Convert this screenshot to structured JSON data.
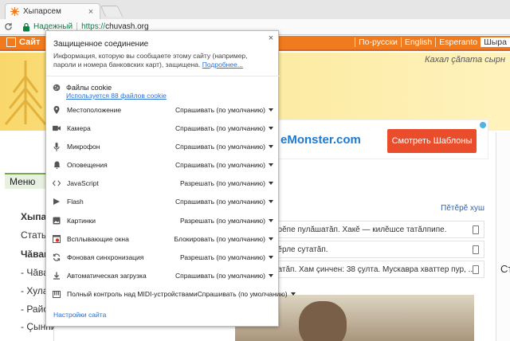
{
  "browser": {
    "tab_title": "Хыпарсем",
    "tab_close": "×",
    "secure_label": "Надежный",
    "url_scheme": "https://",
    "url_host": "chuvash.org"
  },
  "site": {
    "brand": "Сайт",
    "languages": [
      "По-русски",
      "English",
      "Esperanto",
      "Шыра"
    ],
    "motto": "Кахал çăпата сырн",
    "menu_title": "Меню",
    "nav": [
      "Хыпар",
      "Статы",
      "Чăваш",
      "- Чăва",
      "- Хула",
      "- Райо",
      "- Çынписем"
    ],
    "ad_text": "eMonster.com",
    "ad_button": "Смотреть Шаблоны",
    "news_more": "Пĕтĕрĕ хуш",
    "news": [
      "ĕрĕпе пулăшатăп. Хакĕ — килĕшсе татăлпипе.",
      "пĕрле сутатăп.",
      "ратăп. Хам çинчен: 38 çулта. Мускавра хваттер пур, ..."
    ],
    "right_label": "Ст"
  },
  "popup": {
    "title": "Защищенное соединение",
    "description": "Информация, которую вы сообщаете этому сайту (например, пароли и номера банковских карт), защищена.",
    "more_link": "Подробнее...",
    "close": "×",
    "cookies_title": "Файлы cookie",
    "cookies_link": "Используется 88 файлов cookie",
    "permissions": [
      {
        "icon": "location-icon",
        "label": "Местоположение",
        "value": "Спрашивать (по умолчанию)"
      },
      {
        "icon": "camera-icon",
        "label": "Камера",
        "value": "Спрашивать (по умолчанию)"
      },
      {
        "icon": "microphone-icon",
        "label": "Микрофон",
        "value": "Спрашивать (по умолчанию)"
      },
      {
        "icon": "notifications-icon",
        "label": "Оповещения",
        "value": "Спрашивать (по умолчанию)"
      },
      {
        "icon": "javascript-icon",
        "label": "JavaScript",
        "value": "Разрешать (по умолчанию)"
      },
      {
        "icon": "flash-icon",
        "label": "Flash",
        "value": "Спрашивать (по умолчанию)"
      },
      {
        "icon": "images-icon",
        "label": "Картинки",
        "value": "Разрешать (по умолчанию)"
      },
      {
        "icon": "popups-icon",
        "label": "Всплывающие окна",
        "value": "Блокировать (по умолчанию)"
      },
      {
        "icon": "sync-icon",
        "label": "Фоновая синхронизация",
        "value": "Разрешать (по умолчанию)"
      },
      {
        "icon": "download-icon",
        "label": "Автоматическая загрузка",
        "value": "Спрашивать (по умолчанию)"
      },
      {
        "icon": "midi-icon",
        "label": "Полный контроль над MIDI-устройствами",
        "value": "Спрашивать (по умолчанию)"
      }
    ],
    "settings_link": "Настройки сайта"
  },
  "colors": {
    "accent_orange": "#f07a1e",
    "secure_green": "#0b8043",
    "link_blue": "#2a6fd6",
    "ad_button": "#ea4d2c"
  }
}
